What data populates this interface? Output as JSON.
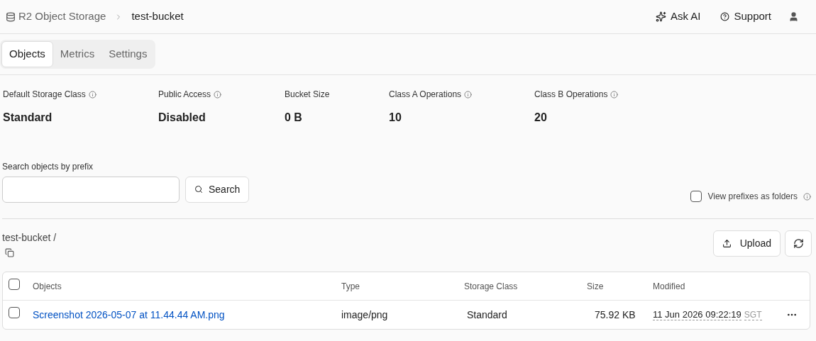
{
  "breadcrumb": {
    "root": "R2 Object Storage",
    "current": "test-bucket"
  },
  "header_actions": {
    "ask_ai": "Ask AI",
    "support": "Support"
  },
  "tabs": [
    {
      "label": "Objects",
      "selected": true
    },
    {
      "label": "Metrics",
      "selected": false
    },
    {
      "label": "Settings",
      "selected": false
    }
  ],
  "stats": [
    {
      "label": "Default Storage Class",
      "value": "Standard",
      "info": true
    },
    {
      "label": "Public Access",
      "value": "Disabled",
      "info": true
    },
    {
      "label": "Bucket Size",
      "value": "0 B",
      "info": false
    },
    {
      "label": "Class A Operations",
      "value": "10",
      "info": true
    },
    {
      "label": "Class B Operations",
      "value": "20",
      "info": true
    }
  ],
  "search": {
    "label": "Search objects by prefix",
    "button": "Search"
  },
  "view_prefixes": {
    "label": "View prefixes as folders",
    "checked": false
  },
  "path": "test-bucket /",
  "upload_button": "Upload",
  "table": {
    "columns": [
      "Objects",
      "Type",
      "Storage Class",
      "Size",
      "Modified"
    ],
    "all_checked": false,
    "rows": [
      {
        "name": "Screenshot 2026-05-07 at 11.44.44 AM.png",
        "type": "image/png",
        "storage_class": "Standard",
        "size": "75.92 KB",
        "modified": "11 Jun 2026 09:22:19",
        "timezone": "SGT",
        "checked": false
      }
    ]
  }
}
